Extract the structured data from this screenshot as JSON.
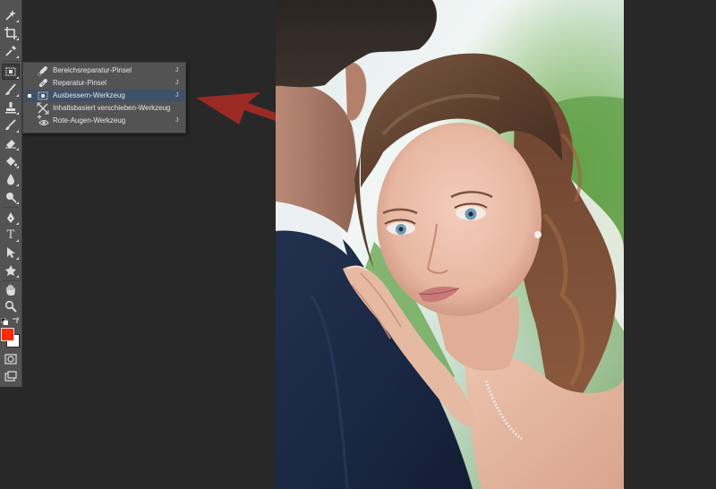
{
  "app": {
    "background_color": "#282828",
    "panel_color": "#535353"
  },
  "toolbar": {
    "tools": [
      {
        "icon": "magic-wand-icon"
      },
      {
        "icon": "crop-icon"
      },
      {
        "icon": "eyedropper-icon"
      },
      {
        "icon": "patch-icon",
        "active": true
      },
      {
        "icon": "brush-icon"
      },
      {
        "icon": "clone-stamp-icon"
      },
      {
        "icon": "history-brush-icon"
      },
      {
        "icon": "eraser-icon"
      },
      {
        "icon": "paint-bucket-icon"
      },
      {
        "icon": "blur-icon"
      },
      {
        "icon": "dodge-icon"
      },
      {
        "icon": "pen-icon"
      },
      {
        "icon": "type-icon",
        "label": "T"
      },
      {
        "icon": "path-selection-icon"
      },
      {
        "icon": "custom-shape-icon"
      },
      {
        "icon": "hand-icon"
      },
      {
        "icon": "zoom-icon"
      }
    ],
    "foreground_color": "#ff2a00",
    "background_color": "#ffffff"
  },
  "flyout": {
    "items": [
      {
        "label": "Bereichsreparatur-Pinsel",
        "shortcut": "J",
        "icon": "spot-healing-brush-icon",
        "selected": false
      },
      {
        "label": "Reparatur-Pinsel",
        "shortcut": "J",
        "icon": "healing-brush-icon",
        "selected": false
      },
      {
        "label": "Ausbessern-Werkzeug",
        "shortcut": "J",
        "icon": "patch-tool-icon",
        "selected": true
      },
      {
        "label": "Inhaltsbasiert verschieben-Werkzeug",
        "shortcut": "",
        "icon": "content-aware-move-icon",
        "selected": false
      },
      {
        "label": "Rote-Augen-Werkzeug",
        "shortcut": "J",
        "icon": "red-eye-icon",
        "selected": false
      }
    ]
  },
  "annotation": {
    "arrow_color": "#9a2a24"
  }
}
